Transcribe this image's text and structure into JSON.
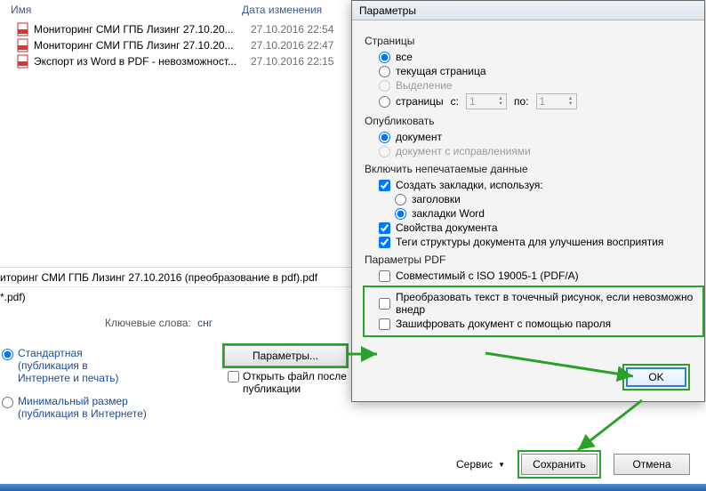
{
  "file_browser": {
    "columns": {
      "name": "Имя",
      "date": "Дата изменения"
    },
    "files": [
      {
        "name": "Мониторинг СМИ ГПБ Лизинг 27.10.20...",
        "date": "27.10.2016 22:54",
        "type": "pdf"
      },
      {
        "name": "Мониторинг СМИ ГПБ Лизинг 27.10.20...",
        "date": "27.10.2016 22:47",
        "type": "pdf"
      },
      {
        "name": "Экспорт из Word в PDF - невозможност...",
        "date": "27.10.2016 22:15",
        "type": "pdf"
      }
    ],
    "filename": "иторинг СМИ ГПБ Лизинг 27.10.2016 (преобразование в pdf).pdf",
    "filetype": "*.pdf)",
    "keywords_label": "Ключевые слова:",
    "keywords_value": "снг",
    "optimize": [
      "Стандартная (публикация в Интернете и печать)",
      "Минимальный размер (публикация в Интернете)"
    ],
    "params_button": "Параметры...",
    "open_after": "Открыть файл после публикации"
  },
  "dialog": {
    "title": "Параметры",
    "pages": {
      "group": "Страницы",
      "all": "все",
      "current": "текущая страница",
      "selection": "Выделение",
      "pages": "страницы",
      "from": "с:",
      "from_val": "1",
      "to": "по:",
      "to_val": "1"
    },
    "publish": {
      "group": "Опубликовать",
      "doc": "документ",
      "doc_rev": "документ с исправлениями"
    },
    "nonprint": {
      "group": "Включить непечатаемые данные",
      "bookmarks": "Создать закладки, используя:",
      "headings": "заголовки",
      "word_bm": "закладки Word",
      "doc_props": "Свойства документа",
      "doc_struct": "Теги структуры документа для улучшения восприятия"
    },
    "pdf_params": {
      "group": "Параметры PDF",
      "iso": "Совместимый с ISO 19005-1 (PDF/A)",
      "bitmap": "Преобразовать текст в точечный рисунок, если невозможно внедр",
      "encrypt": "Зашифровать документ с помощью пароля"
    },
    "ok": "OK"
  },
  "bottom": {
    "service": "Сервис",
    "save": "Сохранить",
    "cancel": "Отмена"
  },
  "colors": {
    "highlight": "#2aa22a",
    "link": "#1a4ea0"
  }
}
